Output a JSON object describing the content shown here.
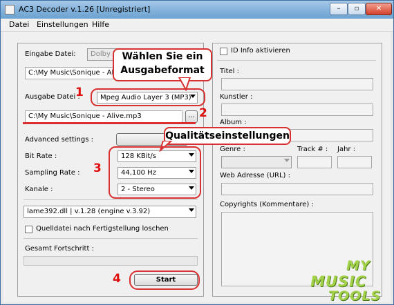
{
  "window": {
    "title": "AC3 Decoder v.1.26 [Unregistriert]"
  },
  "menu": [
    "Datei",
    "Einstellungen",
    "Hilfe"
  ],
  "input": {
    "label": "Eingabe Datei:",
    "format_value": "Dolby",
    "path": "C:\\My Music\\Sonique - Alive.ac3"
  },
  "output": {
    "label": "Ausgabe Datei :",
    "format_value": "Mpeg Audio Layer 3 (MP3)",
    "path": "C:\\My Music\\Sonique - Alive.mp3",
    "browse_label": "..."
  },
  "settings": {
    "advanced_label": "Advanced settings :",
    "bitrate_label": "Bit Rate :",
    "bitrate_value": "128 KBit/s",
    "sampling_label": "Sampling Rate :",
    "sampling_value": "44,100 Hz",
    "channels_label": "Kanale :",
    "channels_value": "2 - Stereo",
    "engine_value": "lame392.dll | v.1.28 (engine v.3.92)",
    "delete_source_label": "Quelldatei nach Fertigstellung loschen",
    "delete_source_checked": false
  },
  "progress": {
    "label": "Gesamt Fortschritt :",
    "value": 0
  },
  "start_label": "Start",
  "id3": {
    "enable_label": "ID Info aktivieren",
    "enabled": false,
    "title_label": "Titel :",
    "artist_label": "Kunstler :",
    "album_label": "Album :",
    "genre_label": "Genre :",
    "track_label": "Track # :",
    "year_label": "Jahr :",
    "url_label": "Web Adresse (URL) :",
    "copyright_label": "Copyrights (Kommentare) :"
  },
  "annotations": {
    "n1": "1",
    "n2": "2",
    "n3": "3",
    "n4": "4",
    "callout_format_line1": "Wählen Sie ein",
    "callout_format_line2": "Ausgabeformat",
    "callout_quality": "Qualitätseinstellungen"
  },
  "logo": {
    "line1": "MY",
    "line2": "MUSIC",
    "line3": "TOOLS"
  },
  "colors": {
    "annotation_red": "#d83030",
    "title_gradient": "#7fb0da",
    "logo_green": "#a3d24a"
  }
}
